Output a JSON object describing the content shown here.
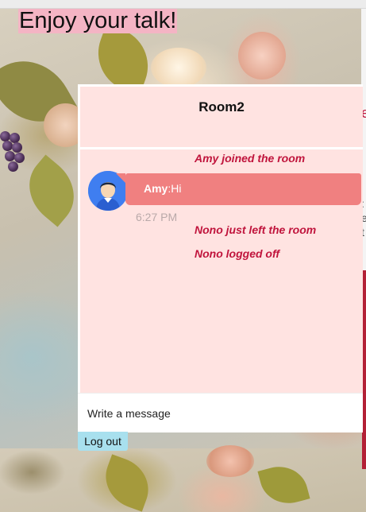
{
  "page": {
    "title": "Enjoy your talk!"
  },
  "chat": {
    "room_name": "Room2",
    "messages": [
      {
        "type": "system",
        "text": "Amy joined the room"
      },
      {
        "type": "user",
        "author": "Amy",
        "separator": ":",
        "text": "Hi",
        "time": "6:27 PM"
      },
      {
        "type": "system",
        "text": "Nono just left the room"
      },
      {
        "type": "system",
        "text": "Nono logged off"
      }
    ],
    "composer": {
      "placeholder": "Write a message",
      "value": ""
    },
    "logout_label": "Log out"
  },
  "side_fragment": {
    "chars": [
      "e",
      ":",
      "e",
      "t",
      ":"
    ]
  },
  "colors": {
    "panel_bg": "#ffe3e1",
    "bubble": "#f08080",
    "system_text": "#c0143c",
    "title_highlight": "#f4b4c4",
    "logout_bg": "#a8e0ee",
    "avatar_bg": "#3f7ef0"
  }
}
